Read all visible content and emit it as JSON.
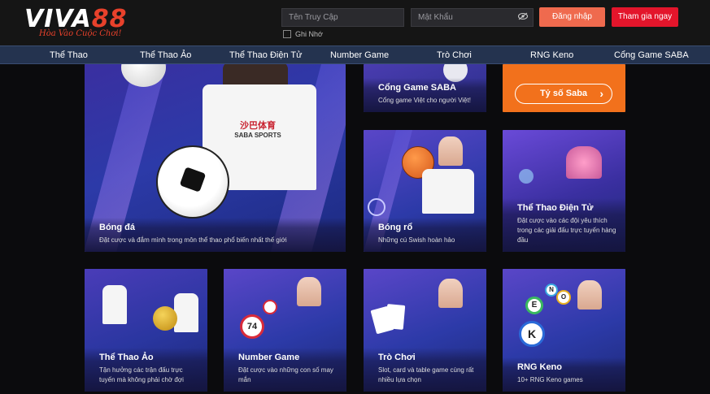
{
  "brand": {
    "logo_white": "VIVA",
    "logo_red": "88",
    "slogan": "Hòa Vào Cuộc Chơi!"
  },
  "login": {
    "username_placeholder": "Tên Truy Cập",
    "password_placeholder": "Mật Khẩu",
    "login_label": "Đăng nhập",
    "join_label": "Tham gia ngay",
    "remember_label": "Ghi Nhớ"
  },
  "nav": {
    "items": [
      "Thể Thao",
      "Thể Thao Ảo",
      "Thể Thao Điện Tử",
      "Number Game",
      "Trò Chơi",
      "RNG Keno",
      "Cổng Game SABA"
    ]
  },
  "cards": {
    "bong_da": {
      "title": "Bóng đá",
      "desc": "Đặt cược và đắm mình trong môn thể thao phổ biến nhất thế giới"
    },
    "cong_game": {
      "title": "Cổng Game SABA",
      "desc": "Cổng game Việt cho người Việt!"
    },
    "ty_so": {
      "button": "Tỷ số Saba",
      "arrow": "›"
    },
    "bong_ro": {
      "title": "Bóng rổ",
      "desc": "Những cú Swish hoàn hảo"
    },
    "dien_tu": {
      "title": "Thể Thao Điện Tử",
      "desc": "Đặt cược vào các đội yêu thích trong các giải đấu trực tuyến hàng đầu"
    },
    "the_thao_ao": {
      "title": "Thể Thao Ảo",
      "desc": "Tận hưởng các trận đấu trực tuyến mà không phải chờ đợi"
    },
    "number_game": {
      "title": "Number Game",
      "desc": "Đặt cược vào những con số may mắn",
      "ball_number": "74"
    },
    "tro_choi": {
      "title": "Trò Chơi",
      "desc": "Slot, card và table game cùng rất nhiều lựa chọn"
    },
    "rng_keno": {
      "title": "RNG Keno",
      "desc": "10+ RNG Keno games",
      "balls": [
        "N",
        "O",
        "E",
        "K"
      ]
    },
    "shirt_brand": {
      "cn": "沙巴体育",
      "en": "SABA SPORTS"
    }
  },
  "colors": {
    "accent": "#e3152b",
    "login_btn": "#ef6a4e",
    "nav_bg": "#24334f",
    "saba_orange": "#f2711c"
  }
}
